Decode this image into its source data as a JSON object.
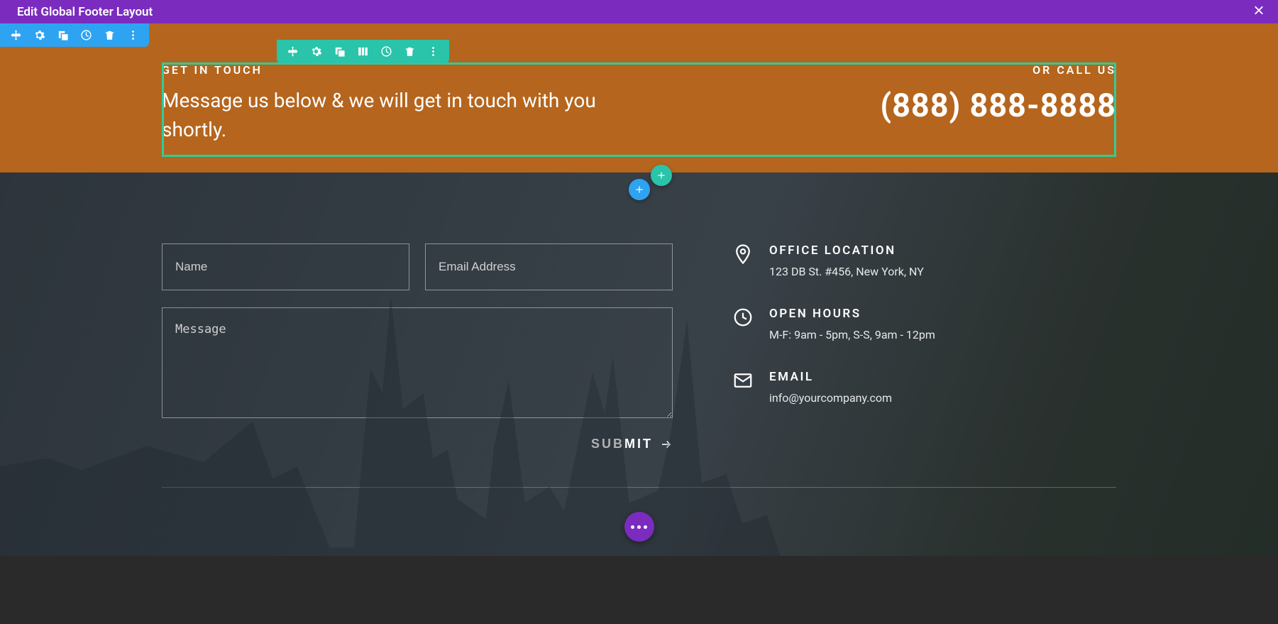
{
  "topbar": {
    "title": "Edit Global Footer Layout"
  },
  "hero": {
    "left_eyebrow": "GET IN TOUCH",
    "left_msg": "Message us below & we will get in touch with you shortly.",
    "right_eyebrow": "OR CALL US",
    "phone": "(888) 888-8888"
  },
  "form": {
    "name_placeholder": "Name",
    "email_placeholder": "Email Address",
    "message_placeholder": "Message",
    "submit_label": "SUBMIT"
  },
  "info": {
    "location_title": "OFFICE LOCATION",
    "location_detail": "123 DB St. #456, New York, NY",
    "hours_title": "OPEN HOURS",
    "hours_detail": "M-F: 9am - 5pm, S-S, 9am - 12pm",
    "email_title": "EMAIL",
    "email_detail": "info@yourcompany.com"
  }
}
